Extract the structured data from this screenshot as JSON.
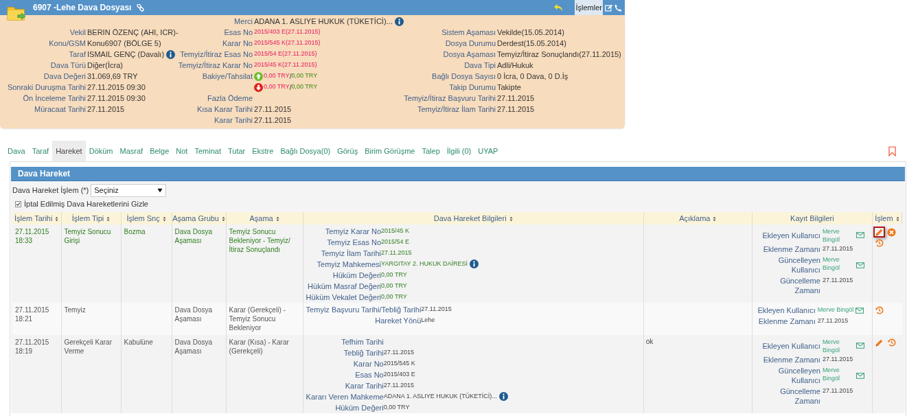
{
  "header": {
    "title": "6907 -Lehe Dava Dosyası",
    "actions_button": "İşlemler"
  },
  "summary": {
    "columns": [
      [
        {
          "label": "Vekil",
          "value": "BERIN ÖZENÇ (AHI, ICR)-",
          "kind": "text",
          "info_icon": false
        },
        {
          "label": "Konu/GSM",
          "value": "Konu6907 (BÖLGE 5)",
          "kind": "text",
          "info_icon": false
        },
        {
          "label": "Taraf",
          "value": "ISMAIL GENÇ (Davalı)",
          "kind": "text",
          "info_icon": true
        },
        {
          "label": "Dava Türü",
          "value": "Diğer(İcra)",
          "kind": "text",
          "info_icon": false
        },
        {
          "label": "Dava Değeri",
          "value": "31.069,69 TRY",
          "kind": "text",
          "info_icon": false
        },
        {
          "label": "Sonraki Duruşma Tarihi",
          "value": "27.11.2015 09:30",
          "kind": "text",
          "info_icon": false
        },
        {
          "label": "Ön İnceleme Tarihi",
          "value": "27.11.2015 09:30",
          "kind": "text",
          "info_icon": false
        },
        {
          "label": "Müracaat Tarihi",
          "value": "27.11.2015",
          "kind": "text",
          "info_icon": false
        }
      ],
      [
        {
          "label": "Merci",
          "value": "ADANA 1. ASLIYE HUKUK (TÜKETİCİ)...",
          "kind": "text",
          "info_icon": true
        },
        {
          "label": "Esas No",
          "value": "2015/403 E(27.11.2015)",
          "kind": "code",
          "info_icon": false
        },
        {
          "label": "Karar No",
          "value": "2015/545 K(27.11.2015)",
          "kind": "code",
          "info_icon": false
        },
        {
          "label": "Temyiz/İtiraz Esas No",
          "value": "2015/54 E(27.11.2015)",
          "kind": "code",
          "info_icon": false
        },
        {
          "label": "Temyiz/İtiraz Karar No",
          "value": "2015/45 K(27.11.2015)",
          "kind": "code",
          "info_icon": false
        },
        {
          "label": "Bakiye/Tahsilat",
          "kind": "balance",
          "increase": true,
          "debit": "0,00 TRY",
          "separator": "/",
          "credit": "0,00 TRY",
          "info_icon": false
        },
        {
          "kind": "balance",
          "increase": false,
          "debit": "0,00 TRY",
          "separator": "/",
          "credit": "0,00 TRY",
          "info_icon": false
        },
        {
          "label": "Fazla Ödeme",
          "kind": "label",
          "info_icon": false
        },
        {
          "label": "Kısa Karar Tarihi",
          "value": "27.11.2015",
          "kind": "text",
          "info_icon": false
        },
        {
          "label": "Karar Tarihi",
          "value": "27.11.2015",
          "kind": "text",
          "info_icon": false
        }
      ],
      [
        {
          "label": "Sistem Aşaması",
          "value": "Vekilde(15.05.2014)",
          "kind": "text",
          "info_icon": false
        },
        {
          "label": "Dosya Durumu",
          "value": "Derdest(15.05.2014)",
          "kind": "text",
          "info_icon": false
        },
        {
          "label": "Dosya Aşaması",
          "value": "Temyiz/İtiraz Sonuçlandı(27.11.2015)",
          "kind": "text",
          "info_icon": false
        },
        {
          "label": "Dava Tipi",
          "value": "Adli/Hukuk",
          "kind": "text",
          "info_icon": false
        },
        {
          "label": "Bağlı Dosya Sayısı",
          "value": "0 İcra, 0 Dava, 0 D.İş",
          "kind": "text",
          "info_icon": false
        },
        {
          "label": "Takip Durumu",
          "value": "Takipte",
          "kind": "text",
          "info_icon": false
        },
        {
          "label": "Temyiz/İtiraz Başvuru Tarihi",
          "value": "27.11.2015",
          "kind": "text",
          "info_icon": false
        },
        {
          "label": "Temyiz/İtiraz İlam Tarihi",
          "value": "27.11.2015",
          "kind": "text",
          "info_icon": false
        }
      ]
    ]
  },
  "tabs": [
    {
      "label": "Dava",
      "selected": false
    },
    {
      "label": "Taraf",
      "selected": false
    },
    {
      "label": "Hareket",
      "selected": true
    },
    {
      "label": "Döküm",
      "selected": false
    },
    {
      "label": "Masraf",
      "selected": false
    },
    {
      "label": "Belge",
      "selected": false
    },
    {
      "label": "Not",
      "selected": false
    },
    {
      "label": "Teminat",
      "selected": false
    },
    {
      "label": "Tutar",
      "selected": false
    },
    {
      "label": "Ekstre",
      "selected": false
    },
    {
      "label": "Bağlı Dosya(0)",
      "selected": false
    },
    {
      "label": "Görüş",
      "selected": false
    },
    {
      "label": "Birim Görüşme",
      "selected": false
    },
    {
      "label": "Talep",
      "selected": false
    },
    {
      "label": "İlgili (0)",
      "selected": false
    },
    {
      "label": "UYAP",
      "selected": false
    }
  ],
  "panel": {
    "title": "Dava Hareket",
    "filter_label": "Dava Hareket İşlem (*)",
    "filter_value": "Seçiniz",
    "hide_cancelled": {
      "label": "İptal Edilmiş Dava Hareketlerini Gizle",
      "checked": true
    }
  },
  "table": {
    "columns": [
      {
        "label": "İşlem Tarihi",
        "sortable": true
      },
      {
        "label": "İşlem Tipi",
        "sortable": true
      },
      {
        "label": "İşlem Snç",
        "sortable": true
      },
      {
        "label": "Aşama Grubu",
        "sortable": true
      },
      {
        "label": "Aşama",
        "sortable": true
      },
      {
        "label": "Dava Hareket Bilgileri",
        "sortable": true
      },
      {
        "label": "Açıklama",
        "sortable": true
      },
      {
        "label": "Kayıt Bilgileri",
        "sortable": false
      },
      {
        "label": "İşlem",
        "sortable": true
      }
    ],
    "rows": [
      {
        "highlighted": true,
        "date": "27.11.2015 18:33",
        "type": "Temyiz Sonucu Girişi",
        "result": "Bozma",
        "stage_group": "Dava Dosya Aşaması",
        "stage": "Temyiz Sonucu Bekleniyor - Temyiz/İtiraz Sonuçlandı",
        "details": [
          {
            "label": "Temyiz Karar No",
            "value": "2015/45 K",
            "info_icon": false
          },
          {
            "label": "Temyiz Esas No",
            "value": "2015/54 E",
            "info_icon": false
          },
          {
            "label": "Temyiz İlam Tarihi",
            "value": "27.11.2015",
            "info_icon": false
          },
          {
            "label": "Temyiz Mahkemesi",
            "value": "YARGITAY 2. HUKUK DAİRESİ",
            "info_icon": true
          },
          {
            "label": "Hüküm Değeri",
            "value": "0,00 TRY",
            "info_icon": false
          },
          {
            "label": "Hüküm Masraf Değeri",
            "value": "0,00 TRY",
            "info_icon": false
          },
          {
            "label": "Hüküm Vekalet Değeri",
            "value": "0,00 TRY",
            "info_icon": false
          }
        ],
        "record": [
          {
            "label": "Ekleyen Kullanıcı",
            "value": "Merve Bingöl",
            "mail": true
          },
          {
            "label": "Eklenme Zamanı",
            "value": "27.11.2015",
            "mail": false
          },
          {
            "label": "Güncelleyen Kullanıcı",
            "value": "Merve Bingöl",
            "mail": true
          },
          {
            "label": "Güncelleme Zamanı",
            "value": "27.11.2015",
            "mail": false
          }
        ],
        "actions": [
          {
            "kind": "edit",
            "focused": true
          },
          {
            "kind": "delete",
            "focused": false
          },
          {
            "kind": "history",
            "focused": false
          }
        ]
      },
      {
        "highlighted": false,
        "date": "27.11.2015 18:21",
        "type": "Temyiz",
        "stage_group": "Dava Dosya Aşaması",
        "stage": "Karar (Gerekçeli) - Temyiz Sonucu Bekleniyor",
        "details": [
          {
            "label": "Temyiz Başvuru Tarihi/Tebliğ Tarihi",
            "value": "27.11.2015",
            "info_icon": false
          },
          {
            "label": "Hareket Yönü",
            "value": "Lehe",
            "info_icon": false
          }
        ],
        "record": [
          {
            "label": "Ekleyen Kullanıcı",
            "value": "Merve Bingöl",
            "mail": true
          },
          {
            "label": "Eklenme Zamanı",
            "value": "27.11.2015",
            "mail": false
          }
        ],
        "actions": [
          {
            "kind": "history",
            "focused": false
          }
        ]
      },
      {
        "highlighted": false,
        "date": "27.11.2015 18:19",
        "type": "Gerekçeli Karar Verme",
        "result": "Kabulüne",
        "stage_group": "Dava Dosya Aşaması",
        "stage": "Karar (Kısa) - Karar (Gerekçeli)",
        "description": "ok",
        "details": [
          {
            "label": "Tefhim Tarihi",
            "info_icon": false
          },
          {
            "label": "Tebliğ Tarihi",
            "value": "27.11.2015",
            "info_icon": false
          },
          {
            "label": "Karar No",
            "value": "2015/545 K",
            "info_icon": false
          },
          {
            "label": "Esas No",
            "value": "2015/403 E",
            "info_icon": false
          },
          {
            "label": "Karar Tarihi",
            "value": "27.11.2015",
            "info_icon": false
          },
          {
            "label": "Kararı Veren Mahkeme",
            "value": "ADANA 1. ASLIYE HUKUK (TÜKETİCİ)...",
            "info_icon": true
          },
          {
            "label": "Hüküm Değeri",
            "value": "0,00 TRY",
            "info_icon": false
          }
        ],
        "record": [
          {
            "label": "Ekleyen Kullanıcı",
            "value": "Merve Bingöl",
            "mail": true
          },
          {
            "label": "Eklenme Zamanı",
            "value": "27.11.2015",
            "mail": false
          },
          {
            "label": "Güncelleyen Kullanıcı",
            "value": "Merve Bingöl",
            "mail": true
          },
          {
            "label": "Güncelleme Zamanı",
            "value": "27.11.2015",
            "mail": false
          }
        ],
        "actions": [
          {
            "kind": "edit",
            "focused": false
          },
          {
            "kind": "history",
            "focused": false
          }
        ]
      }
    ]
  }
}
